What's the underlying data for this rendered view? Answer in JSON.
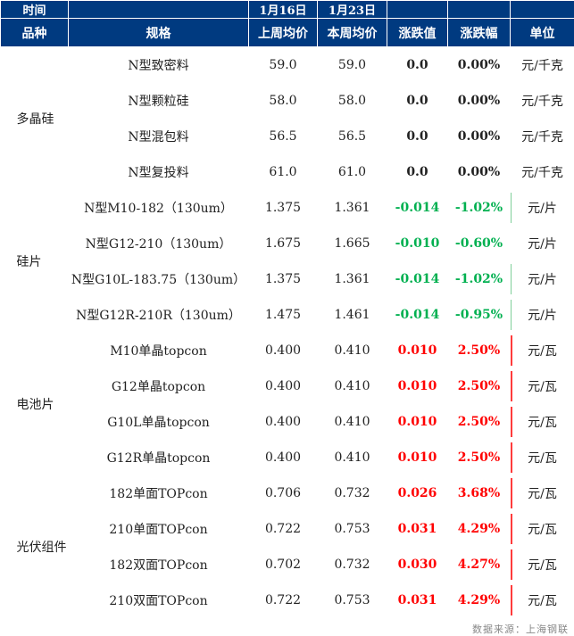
{
  "header": {
    "time_label": "时间",
    "date1": "1月16日",
    "date2": "1月23日",
    "cols": [
      "品种",
      "规格",
      "上周均价",
      "本周均价",
      "涨跌值",
      "涨跌幅",
      "单位"
    ]
  },
  "groups": [
    {
      "name": "多晶硅",
      "rows": [
        {
          "spec": "N型致密料",
          "prev": "59.0",
          "curr": "59.0",
          "chg": "0.0",
          "pct": "0.00%",
          "unit": "元/千克",
          "dir": "flat",
          "bar": 0
        },
        {
          "spec": "N型颗粒硅",
          "prev": "58.0",
          "curr": "58.0",
          "chg": "0.0",
          "pct": "0.00%",
          "unit": "元/千克",
          "dir": "flat",
          "bar": 0
        },
        {
          "spec": "N型混包料",
          "prev": "56.5",
          "curr": "56.5",
          "chg": "0.0",
          "pct": "0.00%",
          "unit": "元/千克",
          "dir": "flat",
          "bar": 0
        },
        {
          "spec": "N型复投料",
          "prev": "61.0",
          "curr": "61.0",
          "chg": "0.0",
          "pct": "0.00%",
          "unit": "元/千克",
          "dir": "flat",
          "bar": 0
        }
      ]
    },
    {
      "name": "硅片",
      "rows": [
        {
          "spec": "N型M10-182（130um）",
          "prev": "1.375",
          "curr": "1.361",
          "chg": "-0.014",
          "pct": "-1.02%",
          "unit": "元/片",
          "dir": "down",
          "bar": 1
        },
        {
          "spec": "N型G12-210（130um）",
          "prev": "1.675",
          "curr": "1.665",
          "chg": "-0.010",
          "pct": "-0.60%",
          "unit": "元/片",
          "dir": "down",
          "bar": 0
        },
        {
          "spec": "N型G10L-183.75（130um）",
          "prev": "1.375",
          "curr": "1.361",
          "chg": "-0.014",
          "pct": "-1.02%",
          "unit": "元/片",
          "dir": "down",
          "bar": 1
        },
        {
          "spec": "N型G12R-210R（130um）",
          "prev": "1.475",
          "curr": "1.461",
          "chg": "-0.014",
          "pct": "-0.95%",
          "unit": "元/片",
          "dir": "down",
          "bar": 1
        }
      ]
    },
    {
      "name": "电池片",
      "rows": [
        {
          "spec": "M10单晶topcon",
          "prev": "0.400",
          "curr": "0.410",
          "chg": "0.010",
          "pct": "2.50%",
          "unit": "元/瓦",
          "dir": "up",
          "bar": 1
        },
        {
          "spec": "G12单晶topcon",
          "prev": "0.400",
          "curr": "0.410",
          "chg": "0.010",
          "pct": "2.50%",
          "unit": "元/瓦",
          "dir": "up",
          "bar": 1
        },
        {
          "spec": "G10L单晶topcon",
          "prev": "0.400",
          "curr": "0.410",
          "chg": "0.010",
          "pct": "2.50%",
          "unit": "元/瓦",
          "dir": "up",
          "bar": 1
        },
        {
          "spec": "G12R单晶topcon",
          "prev": "0.400",
          "curr": "0.410",
          "chg": "0.010",
          "pct": "2.50%",
          "unit": "元/瓦",
          "dir": "up",
          "bar": 1
        }
      ]
    },
    {
      "name": "光伏组件",
      "rows": [
        {
          "spec": "182单面TOPcon",
          "prev": "0.706",
          "curr": "0.732",
          "chg": "0.026",
          "pct": "3.68%",
          "unit": "元/瓦",
          "dir": "up",
          "bar": 1
        },
        {
          "spec": "210单面TOPcon",
          "prev": "0.722",
          "curr": "0.753",
          "chg": "0.031",
          "pct": "4.29%",
          "unit": "元/瓦",
          "dir": "up",
          "bar": 1
        },
        {
          "spec": "182双面TOPcon",
          "prev": "0.702",
          "curr": "0.732",
          "chg": "0.030",
          "pct": "4.27%",
          "unit": "元/瓦",
          "dir": "up",
          "bar": 1
        },
        {
          "spec": "210双面TOPcon",
          "prev": "0.722",
          "curr": "0.753",
          "chg": "0.031",
          "pct": "4.29%",
          "unit": "元/瓦",
          "dir": "up",
          "bar": 1
        }
      ]
    }
  ],
  "source": "数据来源：上海钢联"
}
